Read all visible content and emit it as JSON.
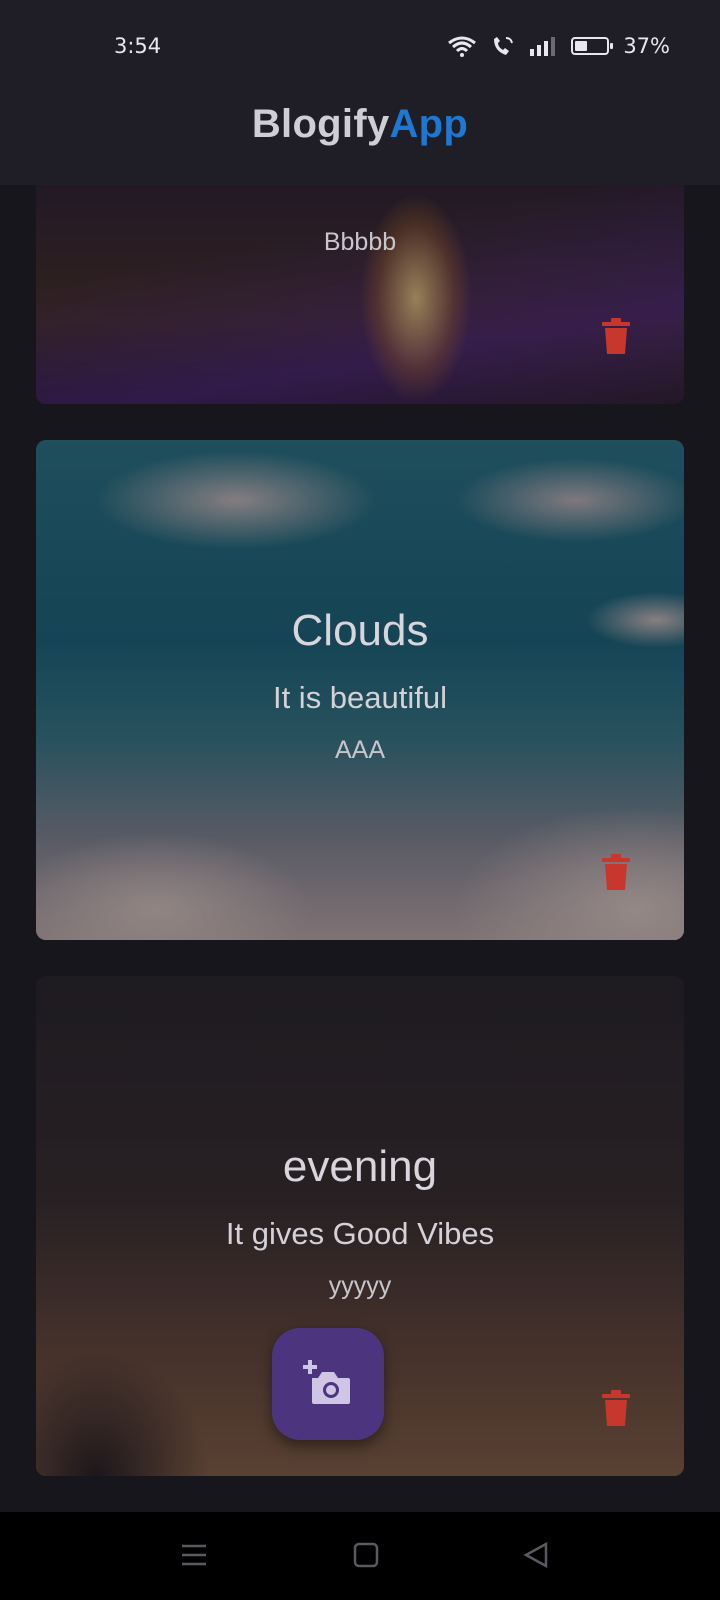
{
  "status_bar": {
    "time": "3:54",
    "battery_percent": "37%",
    "battery_level": 0.37,
    "icons": [
      "wifi-icon",
      "wifi-calling-icon",
      "signal-icon",
      "battery-icon"
    ]
  },
  "app_bar": {
    "title_part1": "Blogify",
    "title_part2": "App",
    "accent_color": "#1e78d2"
  },
  "posts": [
    {
      "title": "",
      "subtitle": "",
      "extra": "Bbbbb",
      "image": "bonfire at night"
    },
    {
      "title": "Clouds",
      "subtitle": "It is beautiful",
      "extra": "AAA",
      "image": "sky with clouds"
    },
    {
      "title": "evening",
      "subtitle": "It gives Good Vibes",
      "extra": "yyyyy",
      "image": "evening sky"
    }
  ],
  "delete_icon_color": "#c8372d",
  "fab": {
    "icon": "add-photo-icon",
    "color": "#4c347e"
  },
  "nav_bar": {
    "buttons": [
      "menu-icon",
      "home-icon",
      "back-icon"
    ]
  }
}
